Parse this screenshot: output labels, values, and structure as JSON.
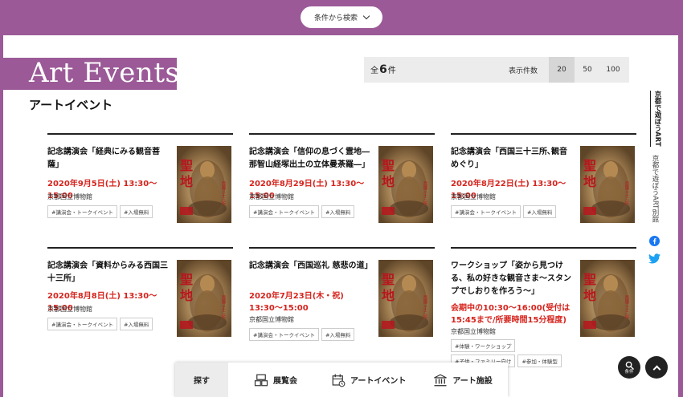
{
  "header": {
    "filter_button_label": "条件から検索"
  },
  "page": {
    "title_en": "Art Events",
    "title_jp": "アートイベント"
  },
  "results": {
    "total_prefix": "全",
    "total_count": "6",
    "total_suffix": "件",
    "per_page_label": "表示件数",
    "per_page_options": [
      "20",
      "50",
      "100"
    ],
    "per_page_selected": "20"
  },
  "events": [
    {
      "title": "記念講演会「経典にみる観音菩薩」",
      "date": "2020年9月5日(土) 13:30〜15:00",
      "venue": "京都国立博物館",
      "tags": [
        "#講演会・トークイベント",
        "#入場無料"
      ]
    },
    {
      "title": "記念講演会「信仰の息づく霊地―那智山経塚出土の立体曼荼羅―」",
      "date": "2020年8月29日(土) 13:30〜15:00",
      "venue": "京都国立博物館",
      "tags": [
        "#講演会・トークイベント",
        "#入場無料"
      ]
    },
    {
      "title": "記念講演会「西国三十三所､観音めぐり」",
      "date": "2020年8月22日(土) 13:30〜15:00",
      "venue": "京都国立博物館",
      "tags": [
        "#講演会・トークイベント",
        "#入場無料"
      ]
    },
    {
      "title": "記念講演会「資料からみる西国三十三所」",
      "date": "2020年8月8日(土) 13:30〜15:00",
      "venue": "京都国立博物館",
      "tags": [
        "#講演会・トークイベント",
        "#入場無料"
      ]
    },
    {
      "title": "記念講演会「西国巡礼 慈悲の道」",
      "date": "2020年7月23日(木・祝) 13:30〜15:00",
      "venue": "京都国立博物館",
      "tags": [
        "#講演会・トークイベント",
        "#入場無料"
      ]
    },
    {
      "title": "ワークショップ「姿から見つける、私の好きな観音さま〜スタンプでしおりを作ろう〜」",
      "date": "会期中の10:30〜16:00(受付は15:45まで/所要時間15分程度)",
      "venue": "京都国立博物館",
      "tags": [
        "#体験・ワークショップ",
        "#子供・ファミリー向け",
        "#参加・体験型"
      ]
    }
  ],
  "poster": {
    "title_chars": "聖地",
    "side_chars": "西国三十三所"
  },
  "sidebar": {
    "tagline_bold": "京都で遊ぼうART",
    "tagline_sub": "京都で遊ぼうART別館",
    "social": [
      "facebook-icon",
      "twitter-icon"
    ]
  },
  "fab": {
    "search_label": "条件"
  },
  "bottom_nav": {
    "search_label": "探す",
    "items": [
      {
        "label": "展覧会",
        "icon": "exhibition-icon"
      },
      {
        "label": "アートイベント",
        "icon": "calendar-icon"
      },
      {
        "label": "アート施設",
        "icon": "museum-icon"
      }
    ]
  },
  "colors": {
    "brand_purple": "#9b5a97",
    "date_red": "#d5241d",
    "facebook_blue": "#1877f2",
    "twitter_blue": "#1da1f2"
  }
}
